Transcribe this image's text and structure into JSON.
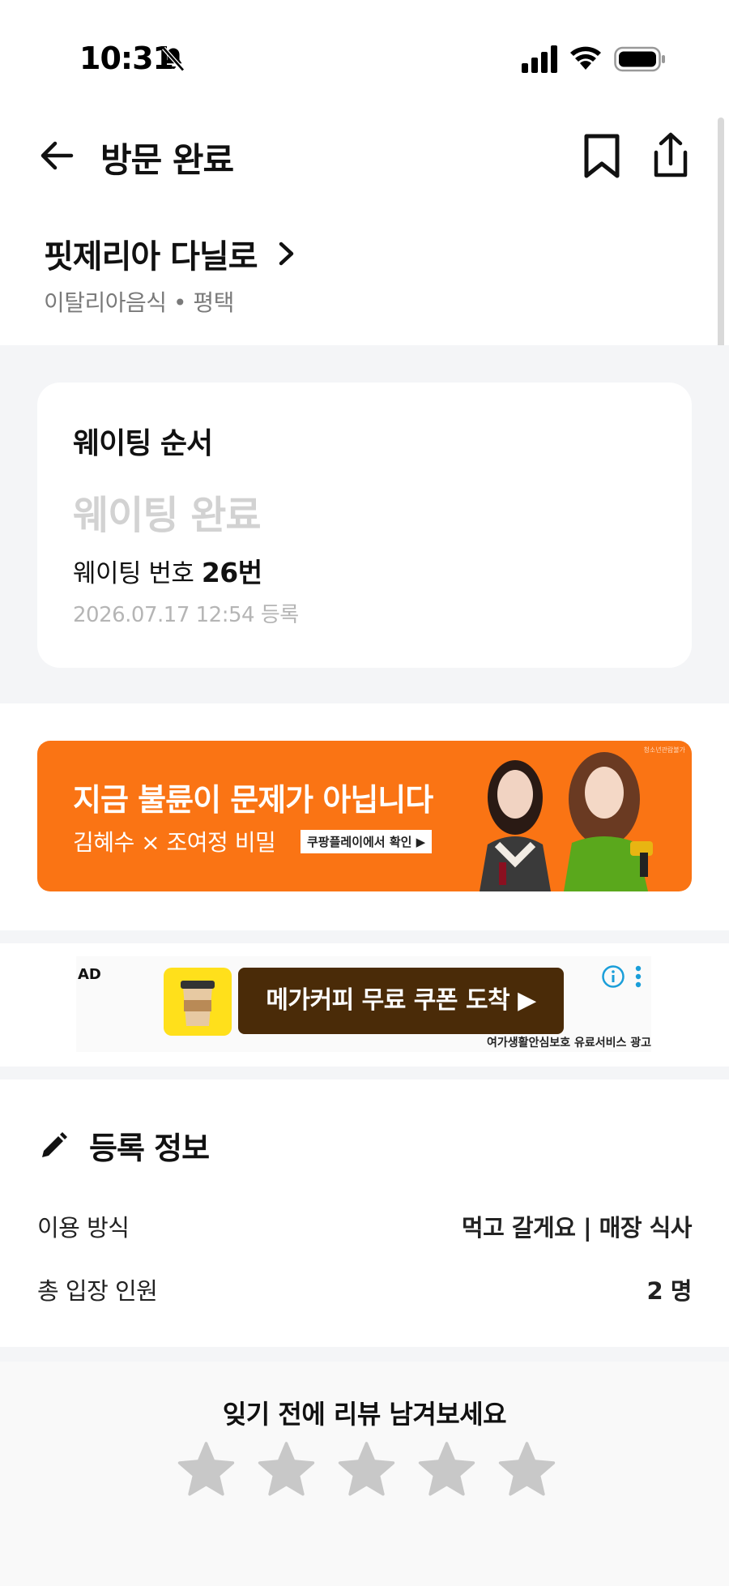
{
  "status_bar": {
    "time": "10:31"
  },
  "header": {
    "title": "방문 완료"
  },
  "store": {
    "name": "핏제리아 다닐로",
    "category_location": "이탈리아음식 • 평택"
  },
  "waiting": {
    "title": "웨이팅 순서",
    "status": "웨이팅 완료",
    "number_label": "웨이팅 번호",
    "number_value": "26번",
    "registered_at": "2026.07.17 12:54 등록"
  },
  "banner": {
    "headline": "지금 불륜이 문제가 아닙니다",
    "subline": "김혜수 × 조여정 비밀",
    "cta": "쿠팡플레이에서 확인 ▶",
    "tag": "청소년관람불가"
  },
  "ad": {
    "label": "AD",
    "button": "메가커피 무료 쿠폰 도착 ▶",
    "disclaimer": "여가생활안심보호 유료서비스 광고"
  },
  "registration": {
    "title": "등록 정보",
    "rows": [
      {
        "label": "이용 방식",
        "value": "먹고 갈게요 | 매장 식사"
      },
      {
        "label": "총 입장 인원",
        "value": "2 명"
      }
    ]
  },
  "review": {
    "title": "잊기 전에 리뷰 남겨보세요",
    "star_count": 5,
    "rating": 0
  },
  "colors": {
    "banner_bg": "#fa7414",
    "ad_button_bg": "#4a2b08",
    "star_inactive": "#c8c8c8",
    "muted_text": "#d2d2d2"
  },
  "icons": [
    "bell-off-icon",
    "signal-icon",
    "wifi-icon",
    "battery-icon",
    "back-arrow-icon",
    "bookmark-icon",
    "share-icon",
    "chevron-right-icon",
    "info-icon",
    "more-vertical-icon",
    "pencil-icon",
    "star-icon"
  ]
}
